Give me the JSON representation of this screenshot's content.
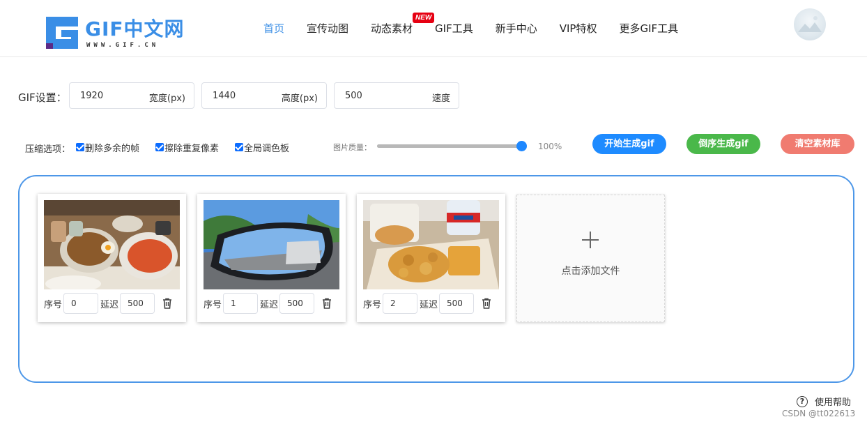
{
  "header": {
    "logo_text": "GIF中文网",
    "logo_sub": "WWW.GIF.CN",
    "nav": [
      {
        "label": "首页",
        "active": true
      },
      {
        "label": "宣传动图",
        "active": false
      },
      {
        "label": "动态素材",
        "active": false
      },
      {
        "label": "GIF工具",
        "active": false
      },
      {
        "label": "新手中心",
        "active": false
      },
      {
        "label": "VIP特权",
        "active": false
      },
      {
        "label": "更多GIF工具",
        "active": false
      }
    ],
    "new_badge": "NEW"
  },
  "settings": {
    "label": "GIF设置：",
    "width": {
      "value": "1920",
      "unit": "宽度(px)"
    },
    "height": {
      "value": "1440",
      "unit": "高度(px)"
    },
    "speed": {
      "value": "500",
      "unit": "速度"
    }
  },
  "compression": {
    "label": "压缩选项：",
    "options": [
      {
        "label": "删除多余的帧",
        "checked": true
      },
      {
        "label": "擦除重复像素",
        "checked": true
      },
      {
        "label": "全局调色板",
        "checked": true
      }
    ],
    "quality_label": "图片质量：",
    "quality_value": "100%",
    "quality_fraction": 1.0
  },
  "buttons": {
    "start": "开始生成gif",
    "reverse": "倒序生成gif",
    "clear": "清空素材库"
  },
  "frames": [
    {
      "order_label": "序号",
      "order": "0",
      "delay_label": "延迟",
      "delay": "500"
    },
    {
      "order_label": "序号",
      "order": "1",
      "delay_label": "延迟",
      "delay": "500"
    },
    {
      "order_label": "序号",
      "order": "2",
      "delay_label": "延迟",
      "delay": "500"
    }
  ],
  "add_file": "点击添加文件",
  "help": "使用帮助",
  "watermark": "CSDN @tt022613",
  "colors": {
    "accent": "#3a8ee6",
    "start_button": "#1e8bff",
    "reverse_button": "#4ab84a",
    "clear_button": "#f07b70",
    "badge": "#e60012",
    "panel_border": "#4d97e8"
  }
}
